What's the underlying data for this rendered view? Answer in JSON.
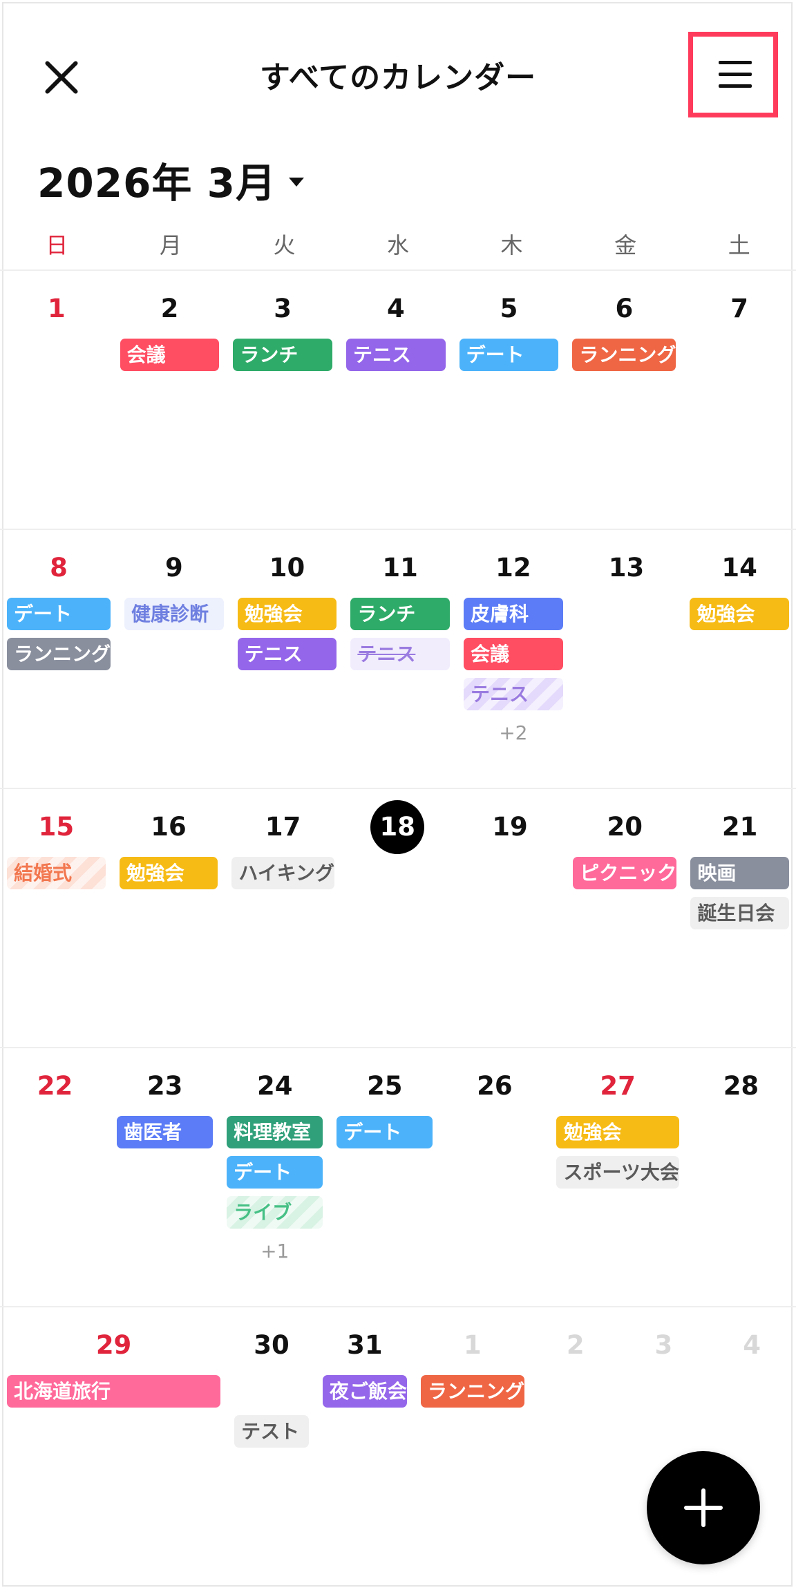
{
  "header": {
    "title": "すべてのカレンダー",
    "close_icon": "close-icon",
    "menu_icon": "hamburger-menu-icon"
  },
  "month_selector": {
    "label": "2026年 3月"
  },
  "weekdays": [
    "日",
    "月",
    "火",
    "水",
    "木",
    "金",
    "土"
  ],
  "weeks": [
    {
      "days": [
        {
          "num": "1",
          "tone": "sun",
          "events": []
        },
        {
          "num": "2",
          "tone": "normal",
          "events": [
            {
              "label": "会議",
              "bg": "#ff4d62",
              "fg": "#ffffff"
            }
          ]
        },
        {
          "num": "3",
          "tone": "normal",
          "events": [
            {
              "label": "ランチ",
              "bg": "#2fab69",
              "fg": "#ffffff"
            }
          ]
        },
        {
          "num": "4",
          "tone": "normal",
          "events": [
            {
              "label": "テニス",
              "bg": "#9466ea",
              "fg": "#ffffff"
            }
          ]
        },
        {
          "num": "5",
          "tone": "normal",
          "events": [
            {
              "label": "デート",
              "bg": "#4cb3fa",
              "fg": "#ffffff"
            }
          ]
        },
        {
          "num": "6",
          "tone": "normal",
          "events": [
            {
              "label": "ランニング",
              "bg": "#ef6645",
              "fg": "#ffffff"
            }
          ]
        },
        {
          "num": "7",
          "tone": "normal",
          "events": []
        }
      ]
    },
    {
      "days": [
        {
          "num": "8",
          "tone": "sun",
          "events": [
            {
              "label": "デート",
              "bg": "#4cb3fa",
              "fg": "#ffffff"
            },
            {
              "label": "ランニング",
              "bg": "#8a8f9e",
              "fg": "#ffffff"
            }
          ]
        },
        {
          "num": "9",
          "tone": "normal",
          "events": [
            {
              "label": "健康診断",
              "bg": "#edf0fd",
              "fg": "#6e7fe0"
            }
          ]
        },
        {
          "num": "10",
          "tone": "normal",
          "events": [
            {
              "label": "勉強会",
              "bg": "#f7bb16",
              "fg": "#ffffff"
            },
            {
              "label": "テニス",
              "bg": "#9466ea",
              "fg": "#ffffff"
            }
          ]
        },
        {
          "num": "11",
          "tone": "normal",
          "events": [
            {
              "label": "ランチ",
              "bg": "#2fab69",
              "fg": "#ffffff"
            },
            {
              "label": "テニス",
              "bg": "#f2edfd",
              "fg": "#9a7be0",
              "style": "strike"
            }
          ]
        },
        {
          "num": "12",
          "tone": "normal",
          "events": [
            {
              "label": "皮膚科",
              "bg": "#5b7cf6",
              "fg": "#ffffff"
            },
            {
              "label": "会議",
              "bg": "#ff4d62",
              "fg": "#ffffff"
            },
            {
              "label": "テニス",
              "bg": "#e4dafb",
              "fg": "#9a7be0",
              "style": "striped"
            }
          ],
          "more": "+2"
        },
        {
          "num": "13",
          "tone": "normal",
          "events": []
        },
        {
          "num": "14",
          "tone": "normal",
          "events": [
            {
              "label": "勉強会",
              "bg": "#f7bb16",
              "fg": "#ffffff"
            }
          ]
        }
      ]
    },
    {
      "days": [
        {
          "num": "15",
          "tone": "sun",
          "events": [
            {
              "label": "結婚式",
              "bg": "#fde0d6",
              "fg": "#f2774f",
              "style": "striped"
            }
          ]
        },
        {
          "num": "16",
          "tone": "normal",
          "events": [
            {
              "label": "勉強会",
              "bg": "#f7bb16",
              "fg": "#ffffff"
            }
          ]
        },
        {
          "num": "17",
          "tone": "normal",
          "events": [
            {
              "label": "ハイキング",
              "bg": "#efefef",
              "fg": "#5a5a5a"
            }
          ]
        },
        {
          "num": "18",
          "tone": "today",
          "events": []
        },
        {
          "num": "19",
          "tone": "normal",
          "events": []
        },
        {
          "num": "20",
          "tone": "normal",
          "events": [
            {
              "label": "ピクニック",
              "bg": "#ff6a9b",
              "fg": "#ffffff"
            }
          ]
        },
        {
          "num": "21",
          "tone": "normal",
          "events": [
            {
              "label": "映画",
              "bg": "#8a8f9e",
              "fg": "#ffffff"
            },
            {
              "label": "誕生日会",
              "bg": "#efefef",
              "fg": "#5a5a5a"
            }
          ]
        }
      ]
    },
    {
      "days": [
        {
          "num": "22",
          "tone": "sun",
          "events": []
        },
        {
          "num": "23",
          "tone": "normal",
          "events": [
            {
              "label": "歯医者",
              "bg": "#5b7cf6",
              "fg": "#ffffff"
            }
          ]
        },
        {
          "num": "24",
          "tone": "normal",
          "events": [
            {
              "label": "料理教室",
              "bg": "#2fa07a",
              "fg": "#ffffff"
            },
            {
              "label": "デート",
              "bg": "#4cb3fa",
              "fg": "#ffffff"
            },
            {
              "label": "ライブ",
              "bg": "#d8f2e4",
              "fg": "#46c085",
              "style": "striped"
            }
          ],
          "more": "+1"
        },
        {
          "num": "25",
          "tone": "normal",
          "events": [
            {
              "label": "デート",
              "bg": "#4cb3fa",
              "fg": "#ffffff"
            }
          ]
        },
        {
          "num": "26",
          "tone": "normal",
          "events": []
        },
        {
          "num": "27",
          "tone": "sun",
          "events": [
            {
              "label": "勉強会",
              "bg": "#f7bb16",
              "fg": "#ffffff"
            },
            {
              "label": "スポーツ大会",
              "bg": "#efefef",
              "fg": "#5a5a5a"
            }
          ]
        },
        {
          "num": "28",
          "tone": "normal",
          "events": []
        }
      ]
    },
    {
      "days": [
        {
          "num": "29",
          "tone": "sun",
          "events": [
            {
              "label": "北海道旅行",
              "bg": "#ff6a9b",
              "fg": "#ffffff",
              "span": 2
            }
          ]
        },
        {
          "num": "30",
          "tone": "normal",
          "events": [
            {
              "label": "テスト",
              "bg": "#efefef",
              "fg": "#5a5a5a",
              "offset": 1
            }
          ]
        },
        {
          "num": "31",
          "tone": "normal",
          "events": [
            {
              "label": "夜ご飯会",
              "bg": "#9466ea",
              "fg": "#ffffff"
            }
          ]
        },
        {
          "num": "1",
          "tone": "dim",
          "events": [
            {
              "label": "ランニング",
              "bg": "#ef6645",
              "fg": "#ffffff"
            }
          ]
        },
        {
          "num": "2",
          "tone": "dim",
          "events": []
        },
        {
          "num": "3",
          "tone": "dim",
          "events": []
        },
        {
          "num": "4",
          "tone": "dim",
          "events": []
        }
      ]
    }
  ],
  "fab": {
    "icon": "plus-icon"
  }
}
